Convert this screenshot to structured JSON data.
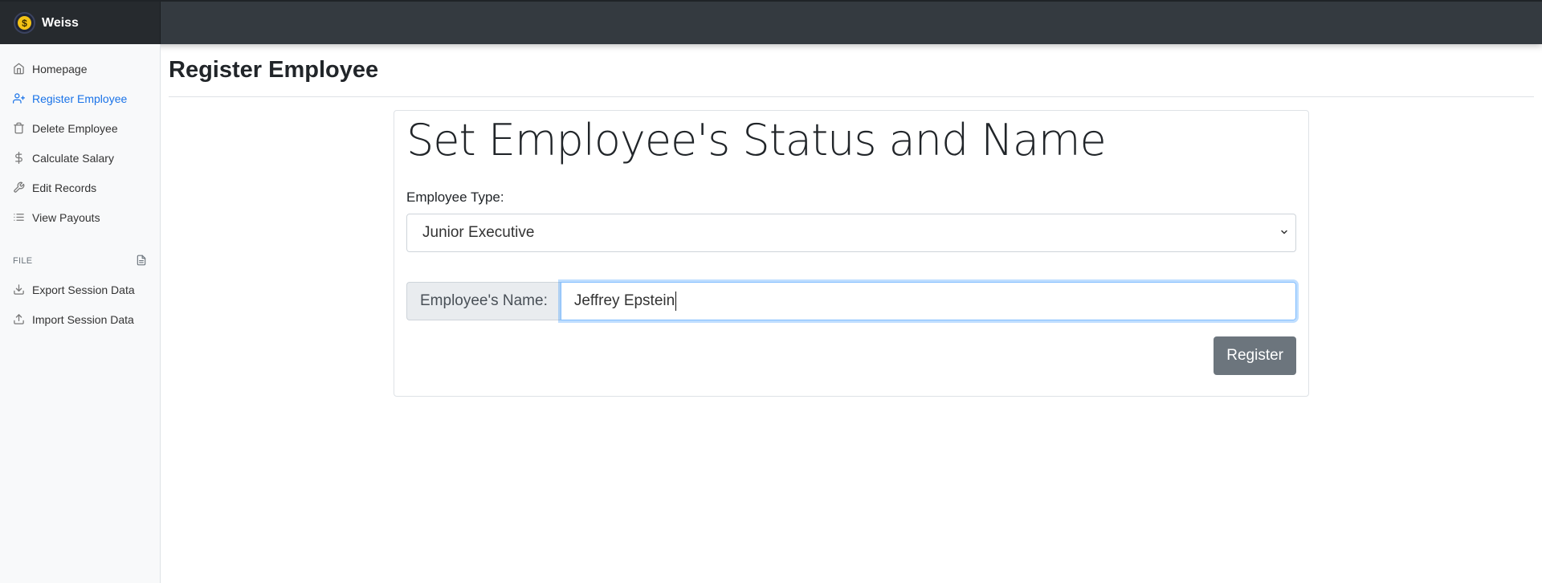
{
  "brand": {
    "name": "Weiss",
    "logo_glyph": "$",
    "logo_color": "#f4c316"
  },
  "sidebar": {
    "items": [
      {
        "label": "Homepage",
        "icon": "home-icon"
      },
      {
        "label": "Register Employee",
        "icon": "user-plus-icon",
        "active": true
      },
      {
        "label": "Delete Employee",
        "icon": "trash-icon"
      },
      {
        "label": "Calculate Salary",
        "icon": "dollar-icon"
      },
      {
        "label": "Edit Records",
        "icon": "wrench-icon"
      },
      {
        "label": "View Payouts",
        "icon": "list-icon"
      }
    ],
    "file_heading": "FILE",
    "file_items": [
      {
        "label": "Export Session Data",
        "icon": "download-icon"
      },
      {
        "label": "Import Session Data",
        "icon": "upload-icon"
      }
    ]
  },
  "page": {
    "title": "Register Employee"
  },
  "form": {
    "card_title": "Set Employee's Status and Name",
    "type_label": "Employee Type:",
    "type_selected": "Junior Executive",
    "name_prefix": "Employee's Name:",
    "name_value": "Jeffrey Epstein",
    "submit_label": "Register"
  },
  "colors": {
    "active": "#1a73e8",
    "navbar": "#343a40",
    "button": "#6c757d"
  }
}
